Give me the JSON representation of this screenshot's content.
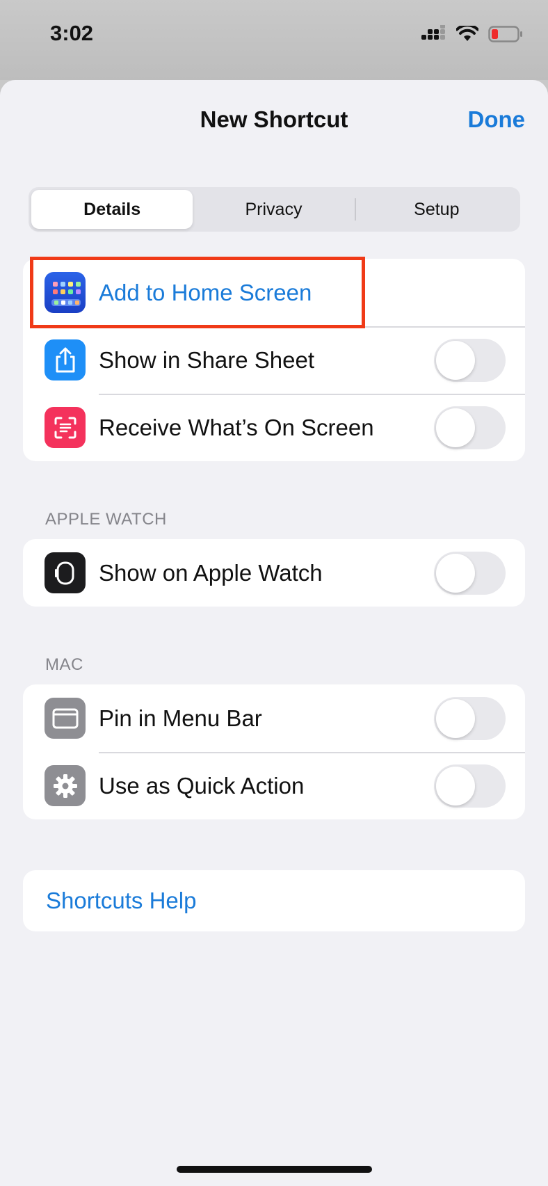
{
  "status_bar": {
    "time": "3:02"
  },
  "nav": {
    "title": "New Shortcut",
    "done_label": "Done"
  },
  "segments": {
    "details": "Details",
    "privacy": "Privacy",
    "setup": "Setup",
    "selected": "Details"
  },
  "group_main": {
    "add_home": "Add to Home Screen",
    "share_sheet": "Show in Share Sheet",
    "on_screen": "Receive What’s On Screen"
  },
  "apple_watch": {
    "header": "APPLE WATCH",
    "show_watch": "Show on Apple Watch"
  },
  "mac": {
    "header": "MAC",
    "pin_menu": "Pin in Menu Bar",
    "quick_action": "Use as Quick Action"
  },
  "help": {
    "label": "Shortcuts Help"
  },
  "toggles": {
    "share_sheet": false,
    "on_screen": false,
    "show_watch": false,
    "pin_menu": false,
    "quick_action": false
  },
  "colors": {
    "accent": "#1a7bd9",
    "highlight": "#f03a17",
    "share_icon": "#1e8ff7",
    "screen_icon": "#f4325c",
    "gray_icon": "#8e8e93"
  }
}
